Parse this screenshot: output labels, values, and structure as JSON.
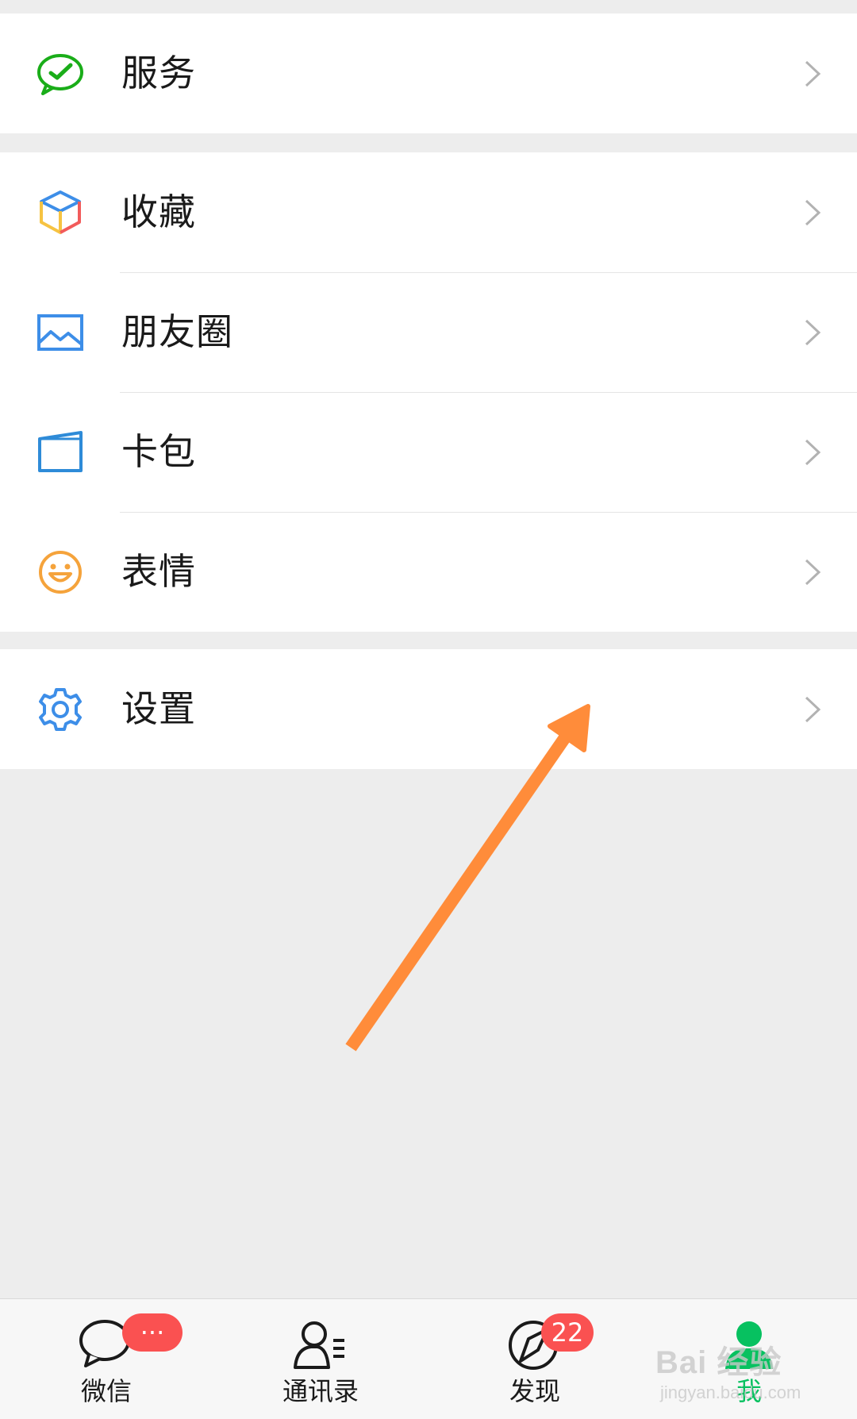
{
  "menu": {
    "service": {
      "label": "服务"
    },
    "favorites": {
      "label": "收藏"
    },
    "moments": {
      "label": "朋友圈"
    },
    "cards": {
      "label": "卡包"
    },
    "stickers": {
      "label": "表情"
    },
    "settings": {
      "label": "设置"
    }
  },
  "tabbar": {
    "tabs": [
      {
        "label": "微信",
        "icon": "chat-bubble-icon",
        "badge": "···"
      },
      {
        "label": "通讯录",
        "icon": "contacts-icon"
      },
      {
        "label": "发现",
        "icon": "compass-icon",
        "badge": "22"
      },
      {
        "label": "我",
        "icon": "me-person-icon",
        "active": true
      }
    ]
  },
  "watermark": {
    "brand": "Bai 经验",
    "url": "jingyan.baidu.com"
  },
  "colors": {
    "accent": "#07c160",
    "badge": "#fa5151",
    "arrow": "#ff8c3a",
    "background": "#ededed"
  }
}
